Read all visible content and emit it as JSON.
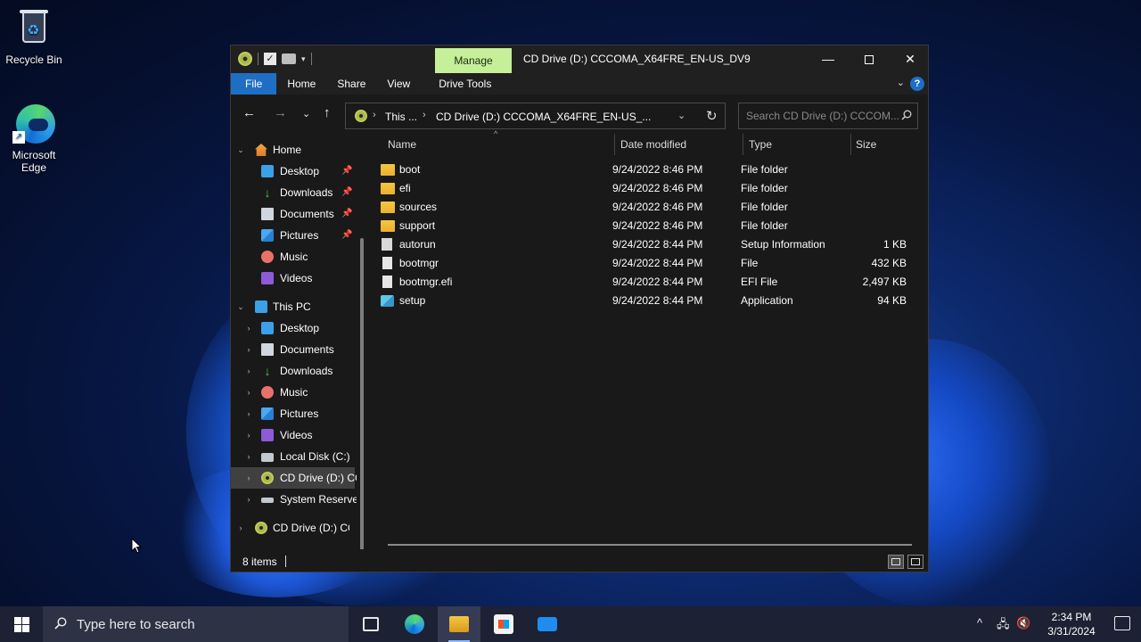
{
  "desktop": {
    "icons": [
      {
        "label": "Recycle Bin"
      },
      {
        "label": "Microsoft Edge"
      }
    ]
  },
  "window": {
    "title": "CD Drive (D:) CCCOMA_X64FRE_EN-US_DV9",
    "manage_tab": "Manage",
    "ribbon_tabs": [
      "File",
      "Home",
      "Share",
      "View",
      "Drive Tools"
    ],
    "address": {
      "crumbs": [
        "This ...",
        "CD Drive (D:) CCCOMA_X64FRE_EN-US_..."
      ]
    },
    "search_placeholder": "Search CD Drive (D:) CCCOM...",
    "nav_pane": [
      {
        "label": "Home",
        "icon": "home-icon",
        "expanded": true
      },
      {
        "label": "Desktop",
        "icon": "desktop-icon",
        "pinned": true
      },
      {
        "label": "Downloads",
        "icon": "download-icon",
        "pinned": true
      },
      {
        "label": "Documents",
        "icon": "documents-icon",
        "pinned": true
      },
      {
        "label": "Pictures",
        "icon": "pictures-icon",
        "pinned": true
      },
      {
        "label": "Music",
        "icon": "music-icon"
      },
      {
        "label": "Videos",
        "icon": "videos-icon"
      },
      {
        "label": "This PC",
        "icon": "pc-icon",
        "expanded": true
      },
      {
        "label": "Desktop",
        "icon": "desktop-icon"
      },
      {
        "label": "Documents",
        "icon": "documents-icon"
      },
      {
        "label": "Downloads",
        "icon": "download-icon"
      },
      {
        "label": "Music",
        "icon": "music-icon"
      },
      {
        "label": "Pictures",
        "icon": "pictures-icon"
      },
      {
        "label": "Videos",
        "icon": "videos-icon"
      },
      {
        "label": "Local Disk (C:)",
        "icon": "disk-icon"
      },
      {
        "label": "CD Drive (D:) CC",
        "icon": "cd-drive-icon",
        "selected": true
      },
      {
        "label": "System Reservec",
        "icon": "system-reserved-icon"
      },
      {
        "label": "CD Drive (D:) CCC",
        "icon": "cd-drive-icon"
      }
    ],
    "columns": {
      "name": "Name",
      "date": "Date modified",
      "type": "Type",
      "size": "Size"
    },
    "files": [
      {
        "name": "boot",
        "date": "9/24/2022 8:46 PM",
        "type": "File folder",
        "size": "",
        "icon": "folder-icon"
      },
      {
        "name": "efi",
        "date": "9/24/2022 8:46 PM",
        "type": "File folder",
        "size": "",
        "icon": "folder-icon"
      },
      {
        "name": "sources",
        "date": "9/24/2022 8:46 PM",
        "type": "File folder",
        "size": "",
        "icon": "folder-icon"
      },
      {
        "name": "support",
        "date": "9/24/2022 8:46 PM",
        "type": "File folder",
        "size": "",
        "icon": "folder-icon"
      },
      {
        "name": "autorun",
        "date": "9/24/2022 8:44 PM",
        "type": "Setup Information",
        "size": "1 KB",
        "icon": "setup-info-icon"
      },
      {
        "name": "bootmgr",
        "date": "9/24/2022 8:44 PM",
        "type": "File",
        "size": "432 KB",
        "icon": "file-icon"
      },
      {
        "name": "bootmgr.efi",
        "date": "9/24/2022 8:44 PM",
        "type": "EFI File",
        "size": "2,497 KB",
        "icon": "file-icon"
      },
      {
        "name": "setup",
        "date": "9/24/2022 8:44 PM",
        "type": "Application",
        "size": "94 KB",
        "icon": "application-icon"
      }
    ],
    "status": {
      "count": "8 items"
    }
  },
  "taskbar": {
    "search_placeholder": "Type here to search",
    "clock": {
      "time": "2:34 PM",
      "date": "3/31/2024"
    }
  },
  "colors": {
    "accent": "#1e6fc4",
    "manage_tab": "#c6ef9a",
    "window_bg": "#191919",
    "taskbar_bg": "#1c2133"
  }
}
